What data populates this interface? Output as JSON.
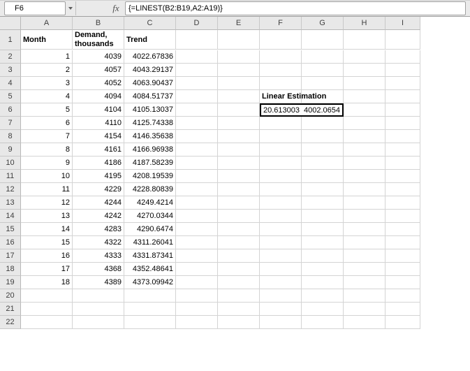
{
  "formula_bar": {
    "cell_ref": "F6",
    "fx_label": "fx",
    "formula": "{=LINEST(B2:B19,A2:A19)}"
  },
  "columns": [
    "A",
    "B",
    "C",
    "D",
    "E",
    "F",
    "G",
    "H",
    "I"
  ],
  "headers": {
    "h1": "Month",
    "h2": "Demand, thousands",
    "h3": "Trend"
  },
  "annotation": {
    "title": "Linear Estimation",
    "slope": "20.613003",
    "intercept": "4002.0654"
  },
  "rows": [
    {
      "n": "1",
      "m": "1",
      "d": "4039",
      "t": "4022.67836"
    },
    {
      "n": "2",
      "m": "2",
      "d": "4057",
      "t": "4043.29137"
    },
    {
      "n": "3",
      "m": "3",
      "d": "4052",
      "t": "4063.90437"
    },
    {
      "n": "4",
      "m": "4",
      "d": "4094",
      "t": "4084.51737"
    },
    {
      "n": "5",
      "m": "5",
      "d": "4104",
      "t": "4105.13037"
    },
    {
      "n": "6",
      "m": "6",
      "d": "4110",
      "t": "4125.74338"
    },
    {
      "n": "7",
      "m": "7",
      "d": "4154",
      "t": "4146.35638"
    },
    {
      "n": "8",
      "m": "8",
      "d": "4161",
      "t": "4166.96938"
    },
    {
      "n": "9",
      "m": "9",
      "d": "4186",
      "t": "4187.58239"
    },
    {
      "n": "10",
      "m": "10",
      "d": "4195",
      "t": "4208.19539"
    },
    {
      "n": "11",
      "m": "11",
      "d": "4229",
      "t": "4228.80839"
    },
    {
      "n": "12",
      "m": "12",
      "d": "4244",
      "t": "4249.4214"
    },
    {
      "n": "13",
      "m": "13",
      "d": "4242",
      "t": "4270.0344"
    },
    {
      "n": "14",
      "m": "14",
      "d": "4283",
      "t": "4290.6474"
    },
    {
      "n": "15",
      "m": "15",
      "d": "4322",
      "t": "4311.26041"
    },
    {
      "n": "16",
      "m": "16",
      "d": "4333",
      "t": "4331.87341"
    },
    {
      "n": "17",
      "m": "17",
      "d": "4368",
      "t": "4352.48641"
    },
    {
      "n": "18",
      "m": "18",
      "d": "4389",
      "t": "4373.09942"
    }
  ],
  "extra_rows": [
    "20",
    "21",
    "22"
  ],
  "chart_data": {
    "type": "table",
    "title": "Linear Estimation LINEST output",
    "series": [
      {
        "name": "Month",
        "values": [
          1,
          2,
          3,
          4,
          5,
          6,
          7,
          8,
          9,
          10,
          11,
          12,
          13,
          14,
          15,
          16,
          17,
          18
        ]
      },
      {
        "name": "Demand thousands",
        "values": [
          4039,
          4057,
          4052,
          4094,
          4104,
          4110,
          4154,
          4161,
          4186,
          4195,
          4229,
          4244,
          4242,
          4283,
          4322,
          4333,
          4368,
          4389
        ]
      },
      {
        "name": "Trend",
        "values": [
          4022.67836,
          4043.29137,
          4063.90437,
          4084.51737,
          4105.13037,
          4125.74338,
          4146.35638,
          4166.96938,
          4187.58239,
          4208.19539,
          4228.80839,
          4249.4214,
          4270.0344,
          4290.6474,
          4311.26041,
          4331.87341,
          4352.48641,
          4373.09942
        ]
      }
    ],
    "linest": {
      "slope": 20.613003,
      "intercept": 4002.0654
    }
  }
}
